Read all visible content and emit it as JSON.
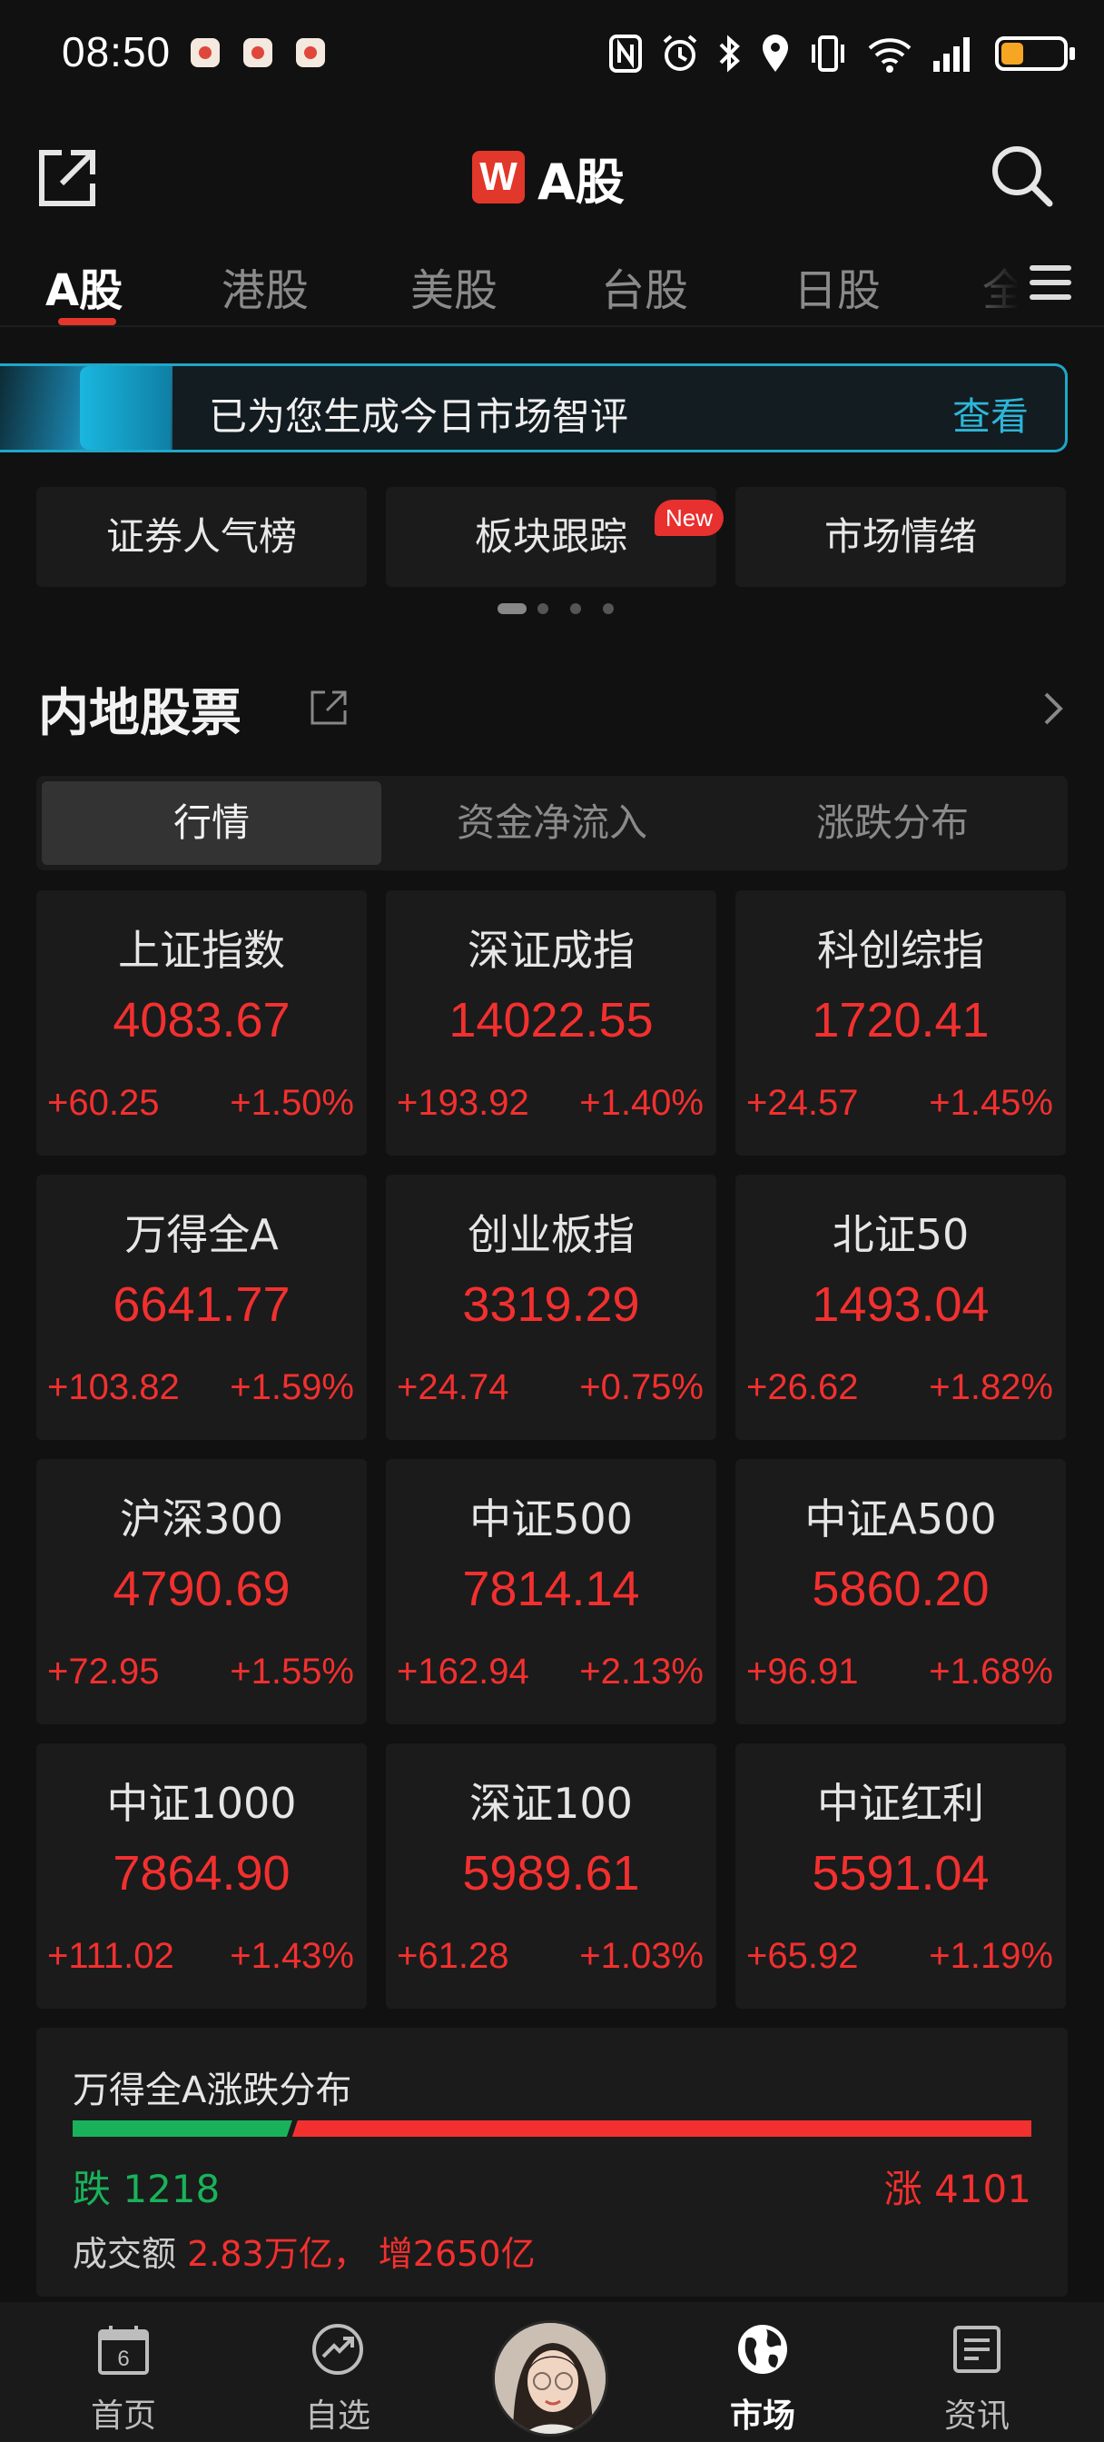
{
  "status_bar": {
    "time": "08:50"
  },
  "header": {
    "logo_letter": "W",
    "title": "A股"
  },
  "market_tabs": [
    {
      "label": "A股",
      "active": true
    },
    {
      "label": "港股"
    },
    {
      "label": "美股"
    },
    {
      "label": "台股"
    },
    {
      "label": "日股"
    },
    {
      "label": "全"
    }
  ],
  "ai_banner": {
    "text": "已为您生成今日市场智评",
    "link": "查看"
  },
  "quick_links": [
    {
      "label": "证券人气榜"
    },
    {
      "label": "板块跟踪",
      "badge": "New"
    },
    {
      "label": "市场情绪"
    }
  ],
  "section": {
    "title": "内地股票"
  },
  "segments": [
    {
      "label": "行情",
      "active": true
    },
    {
      "label": "资金净流入"
    },
    {
      "label": "涨跌分布"
    }
  ],
  "indices": [
    {
      "name": "上证指数",
      "value": "4083.67",
      "change": "+60.25",
      "pct": "+1.50%"
    },
    {
      "name": "深证成指",
      "value": "14022.55",
      "change": "+193.92",
      "pct": "+1.40%"
    },
    {
      "name": "科创综指",
      "value": "1720.41",
      "change": "+24.57",
      "pct": "+1.45%"
    },
    {
      "name": "万得全A",
      "value": "6641.77",
      "change": "+103.82",
      "pct": "+1.59%"
    },
    {
      "name": "创业板指",
      "value": "3319.29",
      "change": "+24.74",
      "pct": "+0.75%"
    },
    {
      "name": "北证50",
      "value": "1493.04",
      "change": "+26.62",
      "pct": "+1.82%"
    },
    {
      "name": "沪深300",
      "value": "4790.69",
      "change": "+72.95",
      "pct": "+1.55%"
    },
    {
      "name": "中证500",
      "value": "7814.14",
      "change": "+162.94",
      "pct": "+2.13%"
    },
    {
      "name": "中证A500",
      "value": "5860.20",
      "change": "+96.91",
      "pct": "+1.68%"
    },
    {
      "name": "中证1000",
      "value": "7864.90",
      "change": "+111.02",
      "pct": "+1.43%"
    },
    {
      "name": "深证100",
      "value": "5989.61",
      "change": "+61.28",
      "pct": "+1.03%"
    },
    {
      "name": "中证红利",
      "value": "5591.04",
      "change": "+65.92",
      "pct": "+1.19%"
    }
  ],
  "distribution": {
    "title": "万得全A涨跌分布",
    "fall_label": "跌 1218",
    "rise_label": "涨 4101",
    "fall_count": 1218,
    "rise_count": 4101,
    "turnover_label": "成交额",
    "turnover_value": "2.83万亿，  增2650亿"
  },
  "bottom_nav": [
    {
      "label": "首页",
      "icon": "calendar-icon"
    },
    {
      "label": "自选",
      "icon": "trend-icon"
    },
    {
      "label": "",
      "icon": "avatar"
    },
    {
      "label": "市场",
      "icon": "globe-icon",
      "active": true
    },
    {
      "label": "资讯",
      "icon": "news-icon"
    }
  ],
  "colors": {
    "up": "#f2302f",
    "down": "#19b25a",
    "accent": "#e2372b",
    "ai": "#2bb6d8"
  }
}
